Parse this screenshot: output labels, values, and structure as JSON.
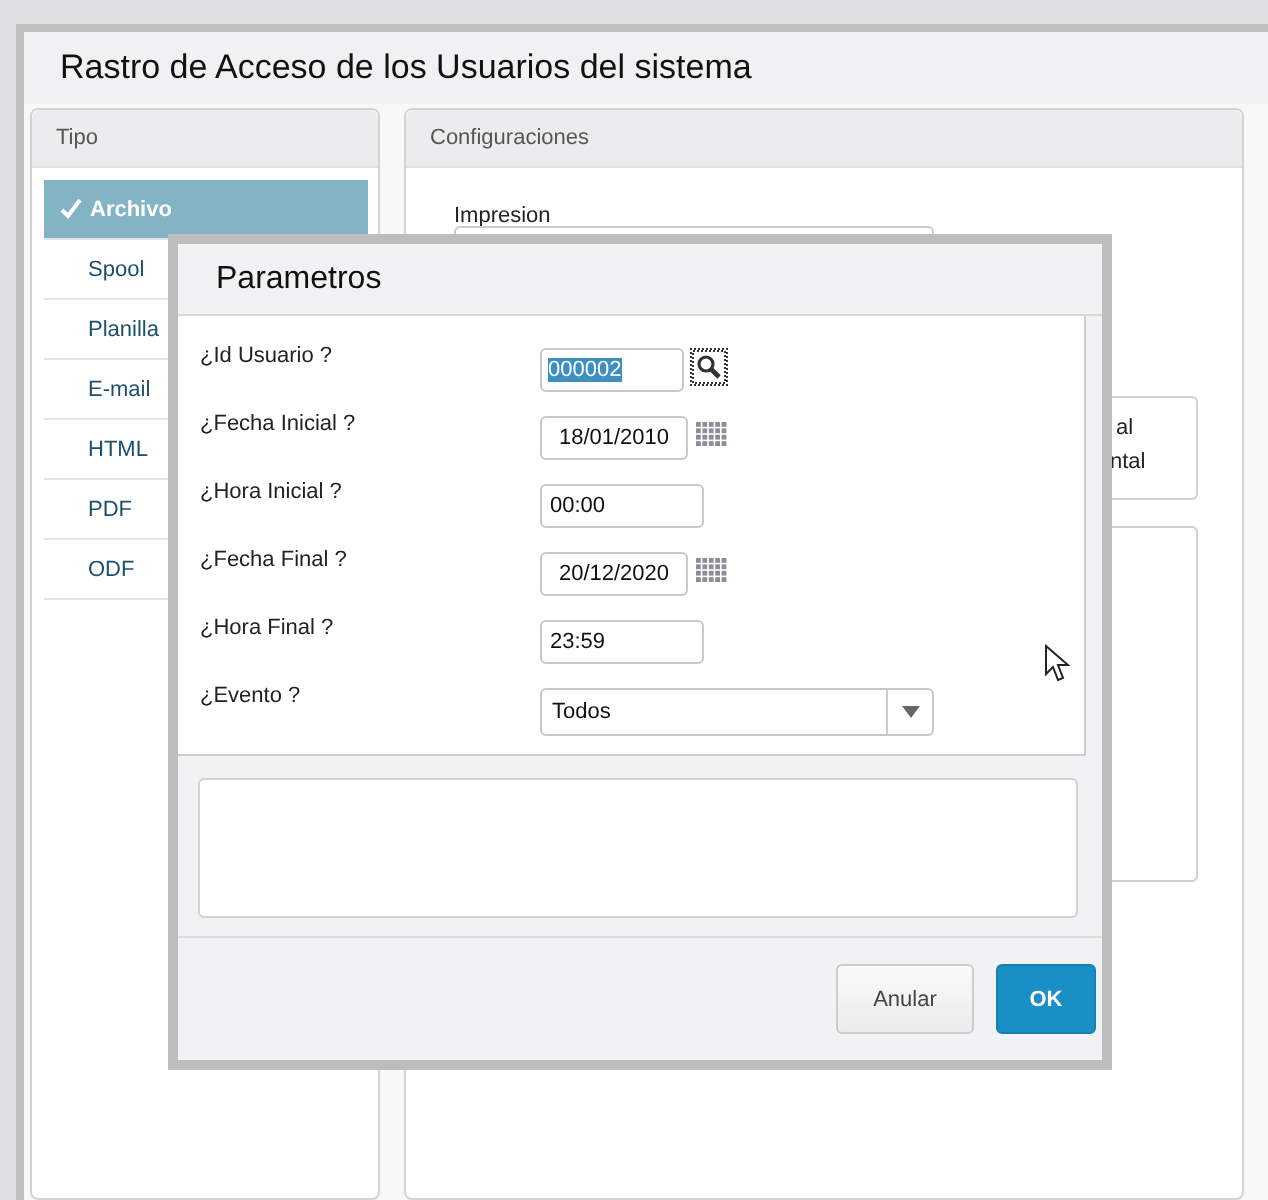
{
  "window": {
    "title": "Rastro de Acceso de los Usuarios del sistema"
  },
  "tipo_panel": {
    "title": "Tipo",
    "items": [
      {
        "label": "Archivo",
        "selected": true
      },
      {
        "label": "Spool",
        "selected": false
      },
      {
        "label": "Planilla",
        "selected": false
      },
      {
        "label": "E-mail",
        "selected": false
      },
      {
        "label": "HTML",
        "selected": false
      },
      {
        "label": "PDF",
        "selected": false
      },
      {
        "label": "ODF",
        "selected": false
      }
    ]
  },
  "config_panel": {
    "title": "Configuraciones",
    "impresion_label": "Impresion",
    "option_texts": [
      "al",
      "ntal"
    ]
  },
  "dialog": {
    "title": "Parametros",
    "fields": [
      {
        "kind": "lookup",
        "label": "¿Id Usuario ?",
        "value": "000002",
        "text_selected": true
      },
      {
        "kind": "date",
        "label": "¿Fecha Inicial ?",
        "value": "18/01/2010"
      },
      {
        "kind": "time",
        "label": "¿Hora Inicial ?",
        "value": "00:00"
      },
      {
        "kind": "date",
        "label": "¿Fecha Final ?",
        "value": "20/12/2020"
      },
      {
        "kind": "time",
        "label": "¿Hora Final ?",
        "value": "23:59"
      },
      {
        "kind": "select",
        "label": "¿Evento ?",
        "value": "Todos"
      }
    ],
    "buttons": [
      {
        "kind": "secondary",
        "label": "Anular"
      },
      {
        "kind": "primary",
        "label": "OK"
      }
    ]
  }
}
